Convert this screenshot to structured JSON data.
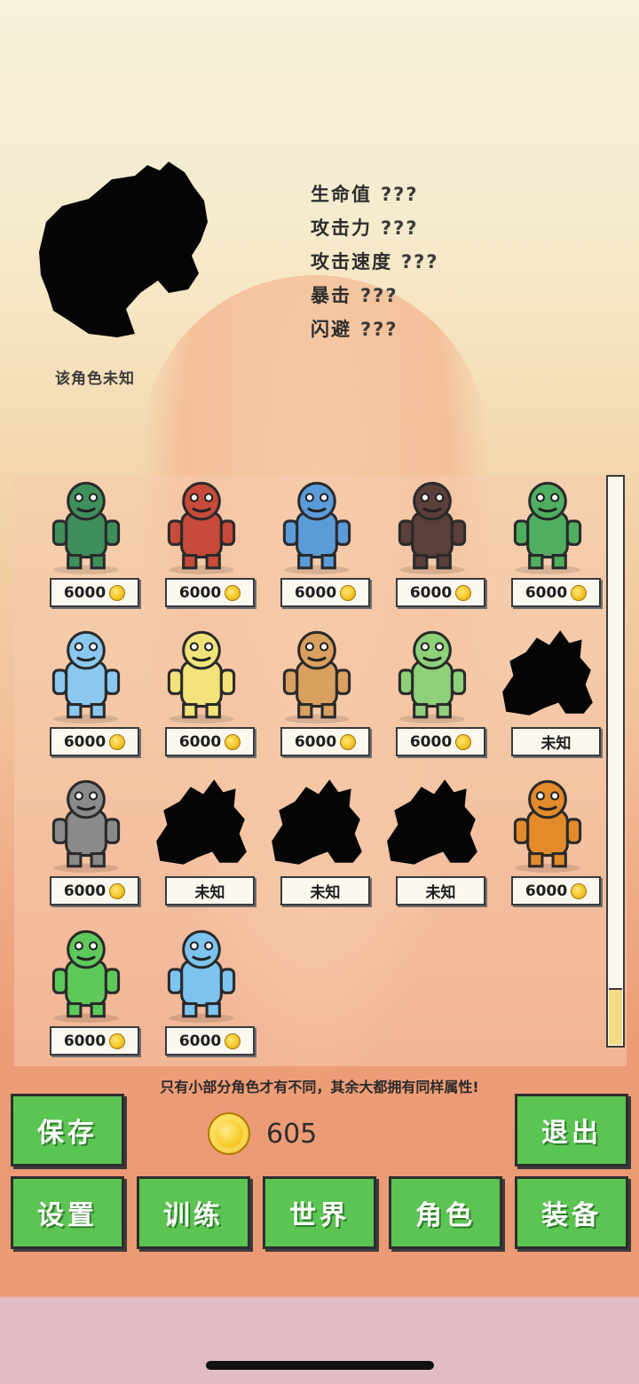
{
  "preview": {
    "label": "该角色未知",
    "sprite": "unknown-silhouette"
  },
  "stats": [
    {
      "name": "生命值",
      "value": "???"
    },
    {
      "name": "攻击力",
      "value": "???"
    },
    {
      "name": "攻击速度",
      "value": "???"
    },
    {
      "name": "暴击",
      "value": "???"
    },
    {
      "name": "闪避",
      "value": "???"
    }
  ],
  "characters": [
    {
      "label": "6000",
      "locked": false,
      "sprite": "crocodile-warrior",
      "color": "#3f8f5c"
    },
    {
      "label": "6000",
      "locked": false,
      "sprite": "fox-with-pink-blob",
      "color": "#c74a3a"
    },
    {
      "label": "6000",
      "locked": false,
      "sprite": "shark-warrior",
      "color": "#5b9bd8"
    },
    {
      "label": "6000",
      "locked": false,
      "sprite": "rock-golem",
      "color": "#5b3f3a"
    },
    {
      "label": "6000",
      "locked": false,
      "sprite": "mermaid-trident",
      "color": "#4fae5f"
    },
    {
      "label": "6000",
      "locked": false,
      "sprite": "blue-yeti",
      "color": "#8ac8ee"
    },
    {
      "label": "6000",
      "locked": false,
      "sprite": "duck-knight",
      "color": "#f1e27a"
    },
    {
      "label": "6000",
      "locked": false,
      "sprite": "spiky-worm",
      "color": "#d9a060"
    },
    {
      "label": "6000",
      "locked": false,
      "sprite": "green-frog-pink",
      "color": "#8fd07a"
    },
    {
      "label": "未知",
      "locked": true,
      "sprite": "unknown-silhouette",
      "color": "#000000"
    },
    {
      "label": "6000",
      "locked": false,
      "sprite": "gray-seal",
      "color": "#8a8a8a"
    },
    {
      "label": "未知",
      "locked": true,
      "sprite": "unknown-silhouette",
      "color": "#000000"
    },
    {
      "label": "未知",
      "locked": true,
      "sprite": "unknown-silhouette",
      "color": "#000000"
    },
    {
      "label": "未知",
      "locked": true,
      "sprite": "unknown-silhouette",
      "color": "#000000"
    },
    {
      "label": "6000",
      "locked": false,
      "sprite": "fire-spirit",
      "color": "#e38a2a"
    },
    {
      "label": "6000",
      "locked": false,
      "sprite": "green-swirl-spirit",
      "color": "#5ec95a"
    },
    {
      "label": "6000",
      "locked": false,
      "sprite": "water-spirit",
      "color": "#7cc4ee"
    }
  ],
  "hint": "只有小部分角色才有不同，其余大都拥有同样属性!",
  "gold": "605",
  "buttons": {
    "save": "保存",
    "exit": "退出",
    "settings": "设置",
    "train": "训练",
    "world": "世界",
    "character": "角色",
    "equipment": "装备"
  },
  "colors": {
    "button_green": "#5cc452",
    "outline": "#2e2e2e",
    "tag_bg": "#fbf8f0"
  }
}
